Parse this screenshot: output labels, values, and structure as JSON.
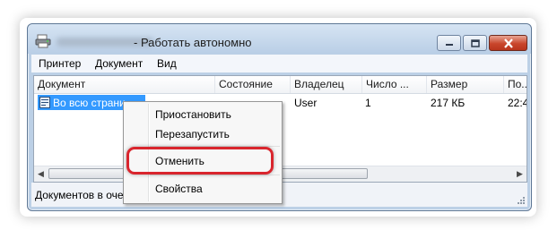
{
  "window": {
    "title": "-  Работать автономно"
  },
  "menubar": {
    "items": [
      "Принтер",
      "Документ",
      "Вид"
    ]
  },
  "table": {
    "columns": [
      "Документ",
      "Состояние",
      "Владелец",
      "Число ...",
      "Размер",
      "По..."
    ],
    "rows": [
      {
        "document": "Во всю страни",
        "status": "",
        "owner": "User",
        "pages": "1",
        "size": "217 КБ",
        "submitted": "22:4"
      }
    ]
  },
  "statusbar": {
    "text": "Документов в оче"
  },
  "context_menu": {
    "items": [
      "Приостановить",
      "Перезапустить",
      "Отменить",
      "Свойства"
    ],
    "highlighted_item": "Отменить",
    "highlight_color": "#d9252d"
  },
  "colors": {
    "selection": "#3399ff",
    "close_button": "#c9462c"
  }
}
